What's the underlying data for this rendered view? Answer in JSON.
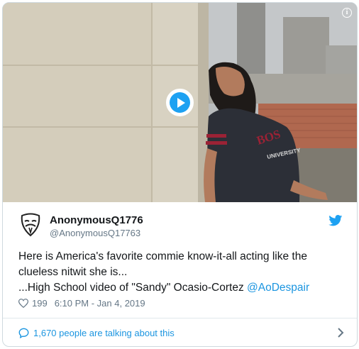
{
  "tweet": {
    "name": "AnonymousQ1776",
    "handle": "@AnonymousQ17763",
    "text_line1": "Here is America's favorite commie know-it-all acting like the",
    "text_line2": "clueless nitwit she is...",
    "text_line3_prefix": "...High School video of \"Sandy\" Ocasio-Cortez ",
    "mention": "@AoDespair",
    "likes": "199",
    "timestamp": "6:10 PM - Jan 4, 2019"
  },
  "media": {
    "info_glyph": "i",
    "shirt_text_top": "BOS",
    "shirt_text_bottom": "UNIVERSITY"
  },
  "footer": {
    "talking_label": "1,670 people are talking about this"
  },
  "colors": {
    "accent": "#1da1f2",
    "link": "#1b95e0",
    "muted": "#657786",
    "text": "#14171a"
  },
  "icons": [
    "info-icon",
    "play-icon",
    "avatar-mask-icon",
    "twitter-bird-icon",
    "heart-icon",
    "speech-bubble-icon",
    "chevron-right-icon"
  ]
}
